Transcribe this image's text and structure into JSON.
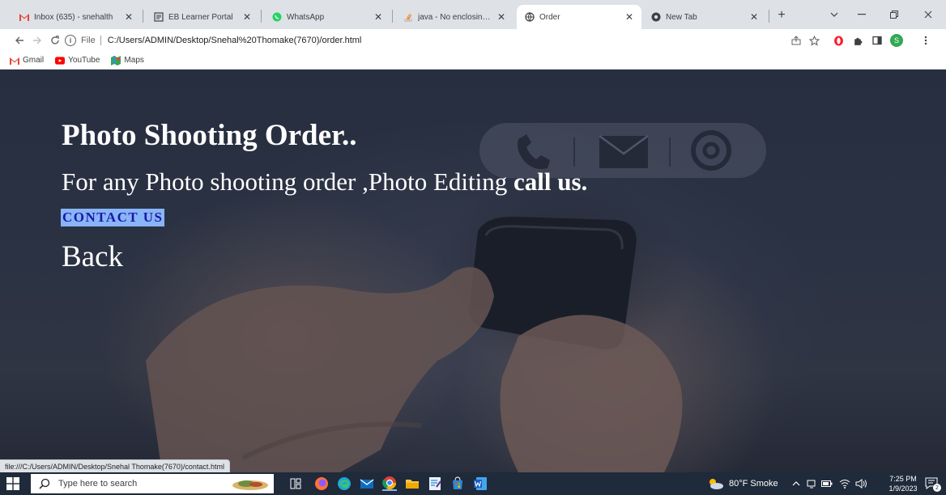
{
  "browser": {
    "tabs": [
      {
        "label": "Inbox (635) - snehalth",
        "icon": "gmail-icon",
        "active": false
      },
      {
        "label": "EB Learner Portal",
        "icon": "portal-icon",
        "active": false
      },
      {
        "label": "WhatsApp",
        "icon": "whatsapp-icon",
        "active": false
      },
      {
        "label": "java - No enclosing in",
        "icon": "stackoverflow-icon",
        "active": false
      },
      {
        "label": "Order",
        "icon": "globe-icon",
        "active": true
      },
      {
        "label": "New Tab",
        "icon": "chrome-icon",
        "active": false
      }
    ],
    "close_glyph": "✕",
    "new_tab_glyph": "+",
    "address": {
      "scheme_label": "File",
      "url": "C:/Users/ADMIN/Desktop/Snehal%20Thomake(7670)/order.html"
    },
    "profile_initial": "S",
    "bookmarks": [
      {
        "label": "Gmail",
        "icon": "gmail-icon"
      },
      {
        "label": "YouTube",
        "icon": "youtube-icon"
      },
      {
        "label": "Maps",
        "icon": "maps-icon"
      }
    ],
    "status_url": "file:///C:/Users/ADMIN/Desktop/Snehal Thomake(7670)/contact.html"
  },
  "page": {
    "heading": "Photo Shooting Order..",
    "subtitle_prefix": "For any Photo shooting order ,Photo Editing ",
    "subtitle_bold": "call us.",
    "contact_link": "CONTACT US",
    "back_link": "Back"
  },
  "taskbar": {
    "search_placeholder": "Type here to search",
    "weather": "80°F Smoke",
    "time": "7:25 PM",
    "date": "1/9/2023",
    "notification_count": "2"
  },
  "colors": {
    "tab_strip": "#dee1e6",
    "link_highlight": "#8ab4f8",
    "link_text": "#1a1aa6",
    "taskbar": "#1f2a3a"
  }
}
